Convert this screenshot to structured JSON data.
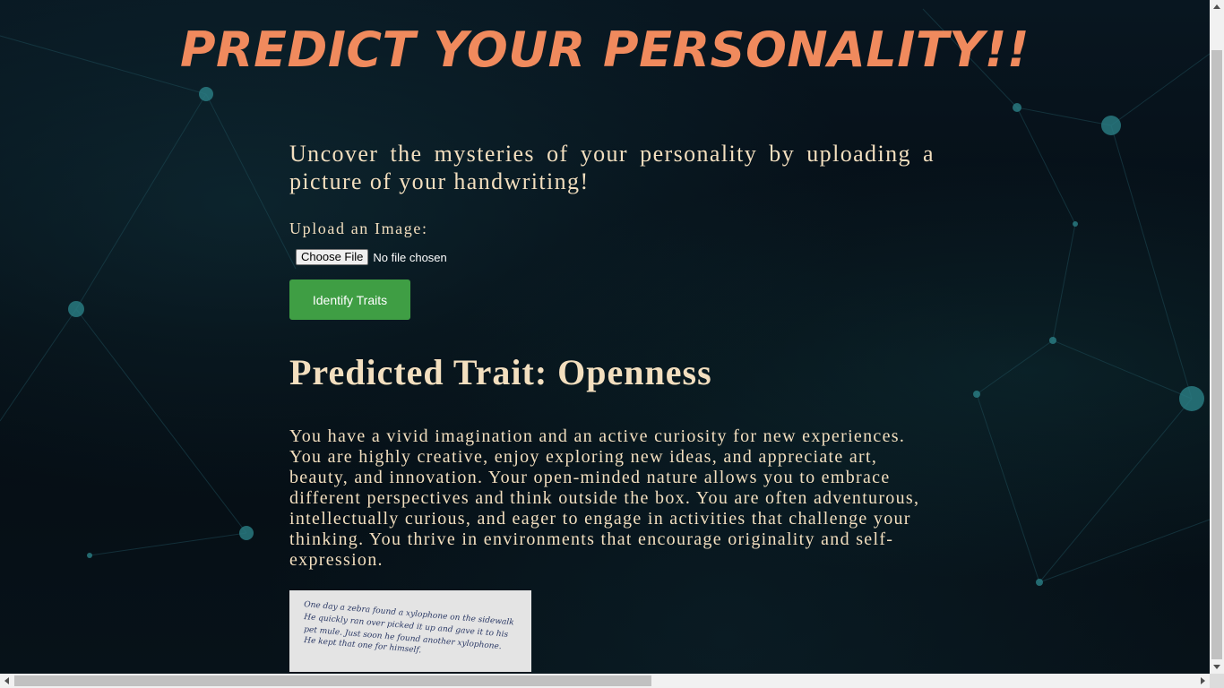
{
  "header": {
    "title": "PREDICT YOUR PERSONALITY!!"
  },
  "main": {
    "intro": "Uncover the mysteries of your personality by uploading a picture of your handwriting!",
    "upload_label": "Upload an Image:",
    "file_button_label": "Choose File",
    "file_status": "No file chosen",
    "submit_label": "Identify Traits",
    "result_heading": "Predicted Trait: Openness",
    "result_description": "You have a vivid imagination and an active curiosity for new experiences. You are highly creative, enjoy exploring new ideas, and appreciate art, beauty, and innovation. Your open-minded nature allows you to embrace different perspectives and think outside the box. You are often adventurous, intellectually curious, and eager to engage in activities that challenge your thinking. You thrive in environments that encourage originality and self-expression.",
    "sample_image": {
      "lines": [
        "One day a zebra found a xylophone on the sidewalk",
        "He quickly ran over picked it up and gave it to his",
        "pet mule. Just soon he found another xylophone.",
        "He kept that one for himself."
      ]
    }
  },
  "colors": {
    "title": "#f08a5d",
    "text": "#f3dfbf",
    "button": "#3f9e44",
    "background": "#050b12"
  }
}
